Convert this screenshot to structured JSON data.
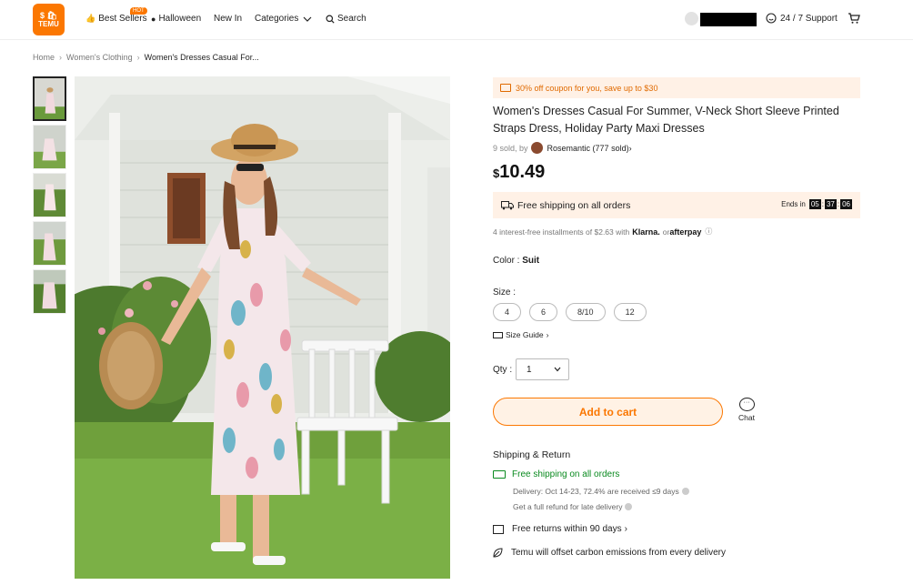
{
  "header": {
    "logo_text_top": "$ 🛍",
    "logo_text": "TEMU",
    "nav": [
      {
        "label": "Best Sellers",
        "icon": "thumbs-up-icon"
      },
      {
        "label": "Halloween",
        "icon": "pumpkin-icon"
      },
      {
        "label": "New In"
      },
      {
        "label": "Categories",
        "icon": "chevron-down-icon"
      },
      {
        "label": "Search",
        "icon": "search-icon"
      }
    ],
    "hot_badge": "HOT",
    "support_label": "24 / 7 Support",
    "accent_color": "#fb7701"
  },
  "breadcrumb": [
    "Home",
    "Women's Clothing",
    "Women's Dresses Casual For..."
  ],
  "product": {
    "coupon": "30% off coupon for you, save up to $30",
    "title": "Women's Dresses Casual For Summer, V-Neck Short Sleeve Printed Straps Dress, Holiday Party Maxi Dresses",
    "sold_prefix": "9 sold, by",
    "store": "Rosemantic (777 sold)",
    "price_currency": "$",
    "price_value": "10.49",
    "shipping_banner": "Free shipping on all orders",
    "ends_in_label": "Ends in",
    "countdown": [
      "05",
      "37",
      "06"
    ],
    "installments": "4 interest-free installments of $2.63 with",
    "klarna": "Klarna.",
    "or": "or",
    "afterpay": "afterpay",
    "color_label": "Color :",
    "color_value": "Suit",
    "size_label": "Size :",
    "sizes": [
      "4",
      "6",
      "8/10",
      "12"
    ],
    "size_guide": "Size Guide",
    "qty_label": "Qty :",
    "qty_value": "1",
    "add_to_cart": "Add to cart",
    "chat": "Chat"
  },
  "shipping_return": {
    "heading": "Shipping & Return",
    "free_shipping": "Free shipping on all orders",
    "delivery": "Delivery: Oct 14-23, 72.4% are received ≤9 days",
    "refund": "Get a full refund for late delivery",
    "returns": "Free returns within 90 days",
    "carbon": "Temu will offset carbon emissions from every delivery"
  }
}
